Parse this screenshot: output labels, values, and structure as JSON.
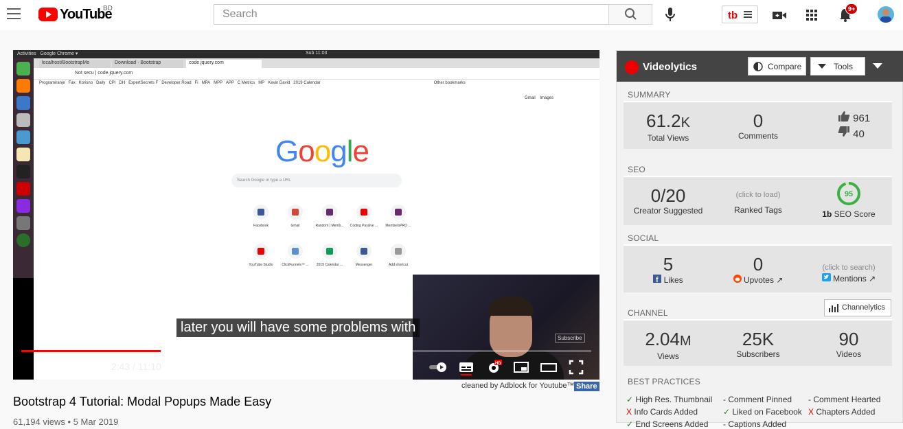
{
  "header": {
    "logo_text": "YouTube",
    "region": "BD",
    "search_placeholder": "Search",
    "notification_count": "9+"
  },
  "player": {
    "os_activities": "Activities",
    "os_app": "Google Chrome ▾",
    "os_clock": "Sub 11:03",
    "chrome_tabs": [
      "localhost/BootstrapMo",
      "Download · Bootstrap",
      "code.jquery.com"
    ],
    "chrome_url_secure": "Not secu",
    "chrome_url": "code.jquery.com",
    "bookmarks": [
      "Programiranje",
      "Fax",
      "Korisno",
      "Daily",
      "CPI",
      "DH",
      "ExpertSecrets F",
      "Developer Road",
      "Fi",
      "MPA",
      "MPP",
      "APP",
      "C Metrics",
      "MP",
      "Kevin David",
      "2019 Calendar",
      "Other bookmarks"
    ],
    "google_links": [
      "Gmail",
      "Images"
    ],
    "google_search_placeholder": "Search Google or type a URL",
    "shortcuts": [
      "Facebook",
      "Gmail",
      "Random | Memb...",
      "Coding Passive ...",
      "MembersPRO ...",
      "YouTube Studio",
      "ClickFunnels™ ...",
      "2019 Calendar ...",
      "Messenger",
      "Add shortcut"
    ],
    "caption": "later you will have some problems with",
    "webcam_watermark": "Subscribe",
    "time": "2:43 / 11:10",
    "played_fraction": 0.245,
    "buffered_fraction": 0.43
  },
  "video": {
    "title": "Bootstrap 4 Tutorial: Modal Popups Made Easy",
    "meta": "61,194 views • 5 Mar 2019",
    "adblock_text": "cleaned by Adblock for Youtube™",
    "adblock_share": "Share"
  },
  "videolytics": {
    "title": "Videolytics",
    "compare_label": "Compare",
    "tools_label": "Tools",
    "summary": {
      "label": "SUMMARY",
      "views": "61.2",
      "views_suffix": "K",
      "views_label": "Total Views",
      "comments": "0",
      "comments_label": "Comments",
      "likes": "961",
      "dislikes": "40"
    },
    "seo": {
      "label": "SEO",
      "creator_value": "0/20",
      "creator_label": "Creator Suggested",
      "ranked_hint": "(click to load)",
      "ranked_label": "Ranked Tags",
      "score": "95",
      "score_label": "SEO Score"
    },
    "social": {
      "label": "SOCIAL",
      "fb_value": "5",
      "fb_label": "Likes",
      "reddit_value": "0",
      "reddit_label": "Upvotes",
      "twitter_hint": "(click to search)",
      "twitter_label": "Mentions"
    },
    "channel": {
      "label": "CHANNEL",
      "button_label": "Channelytics",
      "views": "2.04",
      "views_suffix": "M",
      "views_label": "Views",
      "subs": "25K",
      "subs_label": "Subscribers",
      "videos": "90",
      "videos_label": "Videos"
    },
    "best_practices": {
      "label": "BEST PRACTICES",
      "items": [
        {
          "mark": "✓",
          "text": "High Res. Thumbnail"
        },
        {
          "mark": "-",
          "text": "Comment Pinned"
        },
        {
          "mark": "-",
          "text": "Comment Hearted"
        },
        {
          "mark": "X",
          "text": "Info Cards Added"
        },
        {
          "mark": "✓",
          "text": "Liked on Facebook"
        },
        {
          "mark": "X",
          "text": "Chapters Added"
        },
        {
          "mark": "✓",
          "text": "End Screens Added"
        },
        {
          "mark": "-",
          "text": "Captions Added"
        }
      ]
    }
  },
  "colors": {
    "youtube_red": "#ff0000",
    "videolytics_header": "#444444",
    "seo_green": "#3cb043",
    "link_blue": "#1b6fc6"
  }
}
